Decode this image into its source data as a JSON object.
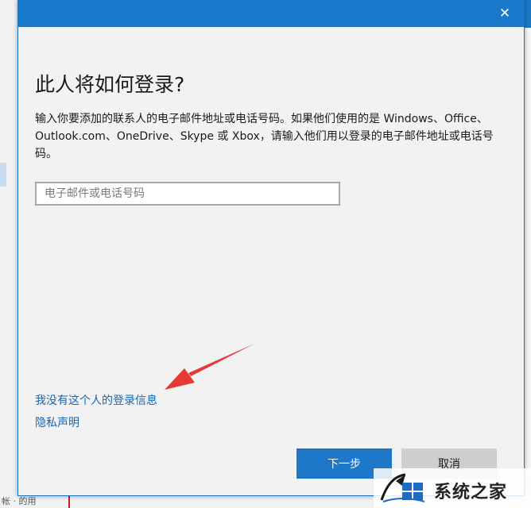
{
  "background": {
    "bottom_text": "帐 · 的用"
  },
  "dialog": {
    "close_glyph": "✕",
    "heading": "此人将如何登录?",
    "description": "输入你要添加的联系人的电子邮件地址或电话号码。如果他们使用的是 Windows、Office、Outlook.com、OneDrive、Skype 或 Xbox，请输入他们用以登录的电子邮件地址或电话号码。",
    "email_input": {
      "placeholder": "电子邮件或电话号码",
      "value": ""
    },
    "links": {
      "no_login_info": "我没有这个人的登录信息",
      "privacy": "隐私声明"
    },
    "buttons": {
      "next": "下一步",
      "cancel": "取消"
    }
  },
  "annotation": {
    "arrow_color": "#e53935"
  },
  "watermark": {
    "text": "系统之家"
  },
  "colors": {
    "accent": "#1979ca",
    "link": "#1466b8",
    "primary_button": "#1e78c8"
  }
}
